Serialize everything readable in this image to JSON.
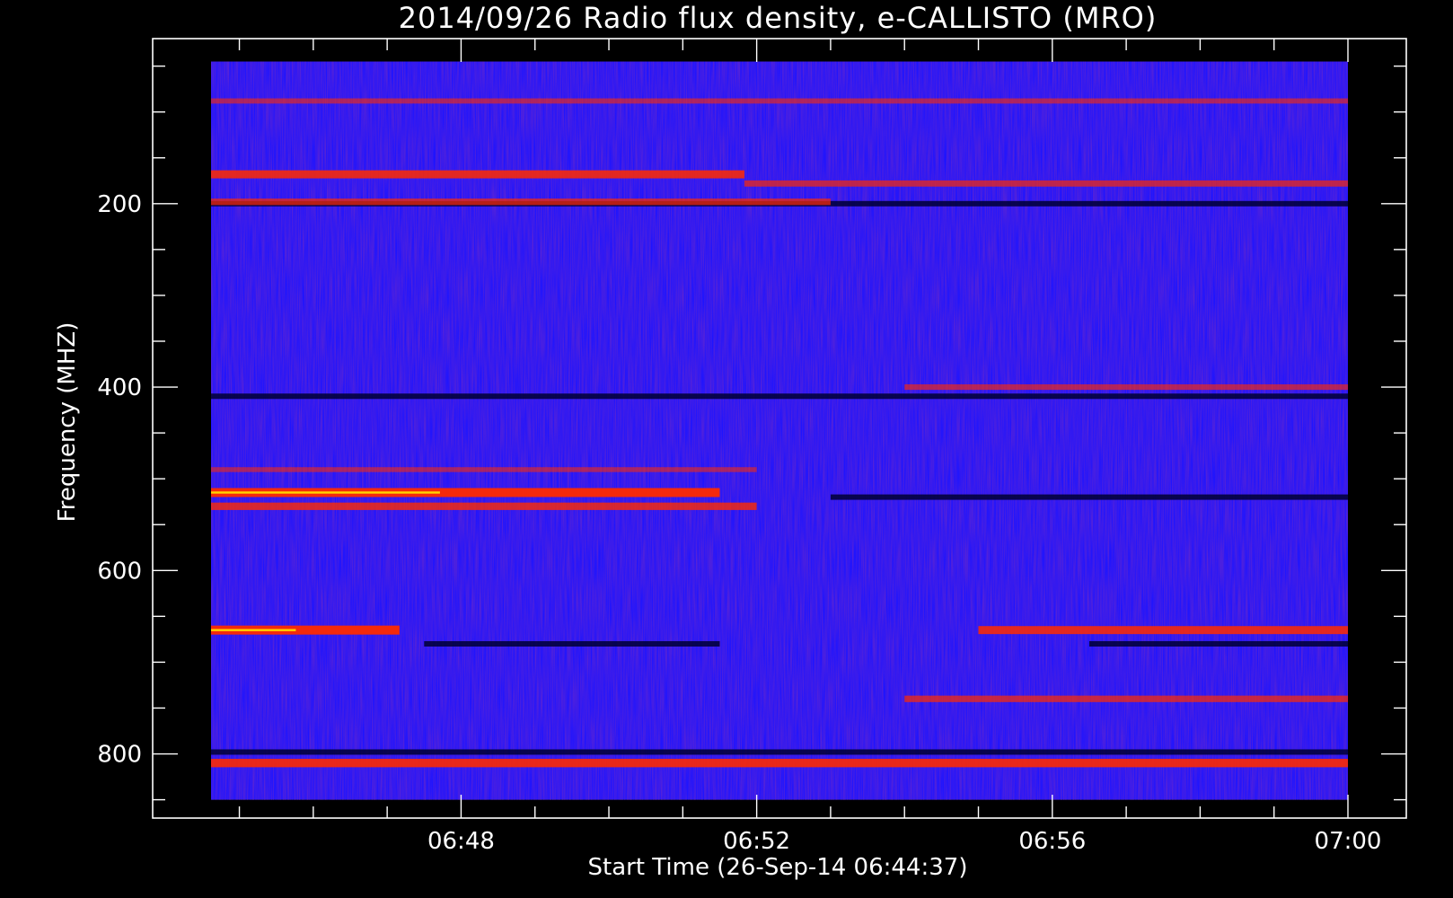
{
  "chart_data": {
    "type": "heatmap",
    "title": "2014/09/26  Radio flux density, e-CALLISTO (MRO)",
    "xlabel": "Start Time (26-Sep-14 06:44:37)",
    "ylabel": "Frequency (MHZ)",
    "x_range": [
      "06:44:37",
      "07:00:00"
    ],
    "xlim": [
      "06:44:37",
      "07:00:00"
    ],
    "ylim": [
      870,
      20
    ],
    "y_data_range": [
      850,
      45
    ],
    "y_inverted": true,
    "x_ticks": [
      "06:48",
      "06:52",
      "06:56",
      "07:00"
    ],
    "y_ticks": [
      200,
      400,
      600,
      800
    ],
    "colormap": {
      "background": "#1e14ff",
      "low": "#000033",
      "high": "#ff2a00",
      "peak": "#fff200"
    },
    "bands": [
      {
        "freq_mhz": 88,
        "from": "06:44:37",
        "to": "07:00:00",
        "intensity": 0.4
      },
      {
        "freq_mhz": 168,
        "from": "06:44:37",
        "to": "06:51:50",
        "intensity": 0.85
      },
      {
        "freq_mhz": 178,
        "from": "06:51:50",
        "to": "07:00:00",
        "intensity": 0.55
      },
      {
        "freq_mhz": 198,
        "from": "06:44:37",
        "to": "06:53:00",
        "intensity": 0.6
      },
      {
        "freq_mhz": 400,
        "from": "06:54:00",
        "to": "07:00:00",
        "intensity": 0.45
      },
      {
        "freq_mhz": 490,
        "from": "06:44:37",
        "to": "06:52:00",
        "intensity": 0.35
      },
      {
        "freq_mhz": 515,
        "from": "06:44:37",
        "to": "06:51:30",
        "intensity": 1.0
      },
      {
        "freq_mhz": 530,
        "from": "06:44:37",
        "to": "06:52:00",
        "intensity": 0.75
      },
      {
        "freq_mhz": 665,
        "from": "06:44:37",
        "to": "06:47:10",
        "intensity": 1.0
      },
      {
        "freq_mhz": 665,
        "from": "06:55:00",
        "to": "07:00:00",
        "intensity": 0.85
      },
      {
        "freq_mhz": 740,
        "from": "06:54:00",
        "to": "07:00:00",
        "intensity": 0.6
      },
      {
        "freq_mhz": 810,
        "from": "06:44:37",
        "to": "07:00:00",
        "intensity": 0.9
      }
    ],
    "dark_bands": [
      {
        "freq_mhz": 200,
        "from": "06:44:37",
        "to": "07:00:00"
      },
      {
        "freq_mhz": 410,
        "from": "06:44:37",
        "to": "07:00:00"
      },
      {
        "freq_mhz": 520,
        "from": "06:53:00",
        "to": "07:00:00"
      },
      {
        "freq_mhz": 680,
        "from": "06:47:30",
        "to": "06:51:30"
      },
      {
        "freq_mhz": 680,
        "from": "06:56:30",
        "to": "07:00:00"
      },
      {
        "freq_mhz": 798,
        "from": "06:44:37",
        "to": "07:00:00"
      }
    ]
  }
}
